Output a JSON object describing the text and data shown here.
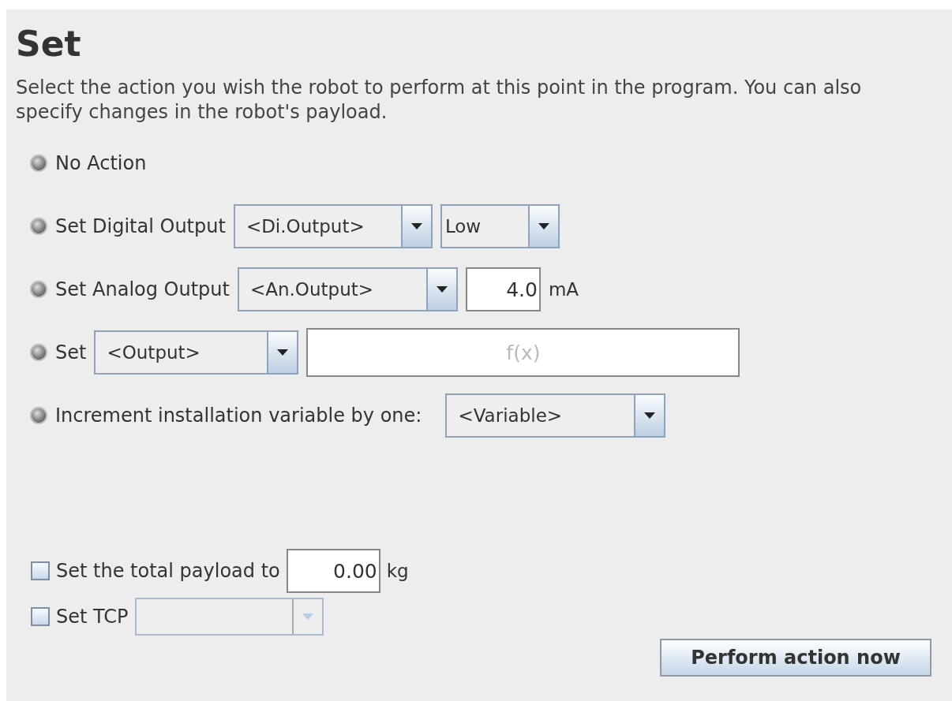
{
  "title": "Set",
  "description": "Select the action you wish the robot to perform at this point in the program. You can also specify changes in the robot's payload.",
  "actions": [
    {
      "label": "No Action",
      "selected": false
    },
    {
      "label": "Set Digital Output",
      "selected": false,
      "controls": [
        {
          "kind": "dropdown",
          "value": "<Di.Output>"
        },
        {
          "kind": "dropdown",
          "value": "Low"
        }
      ]
    },
    {
      "label": "Set Analog Output",
      "selected": false,
      "controls": [
        {
          "kind": "dropdown",
          "value": "<An.Output>"
        },
        {
          "kind": "number",
          "value": "4.0"
        },
        {
          "kind": "unit",
          "text": "mA"
        }
      ]
    },
    {
      "label": "Set",
      "selected": false,
      "controls": [
        {
          "kind": "dropdown",
          "value": "<Output>"
        },
        {
          "kind": "expression",
          "placeholder": "f(x)"
        }
      ]
    },
    {
      "label": "Increment installation variable by one:",
      "selected": false,
      "controls": [
        {
          "kind": "dropdown",
          "value": "<Variable>"
        }
      ]
    }
  ],
  "options": [
    {
      "label": "Set the total payload to",
      "checked": false,
      "controls": [
        {
          "kind": "number",
          "value": "0.00"
        },
        {
          "kind": "unit",
          "text": "kg"
        }
      ]
    },
    {
      "label": "Set TCP",
      "checked": false,
      "controls": [
        {
          "kind": "dropdown",
          "disabled": true
        }
      ]
    }
  ],
  "button": "Perform action now"
}
